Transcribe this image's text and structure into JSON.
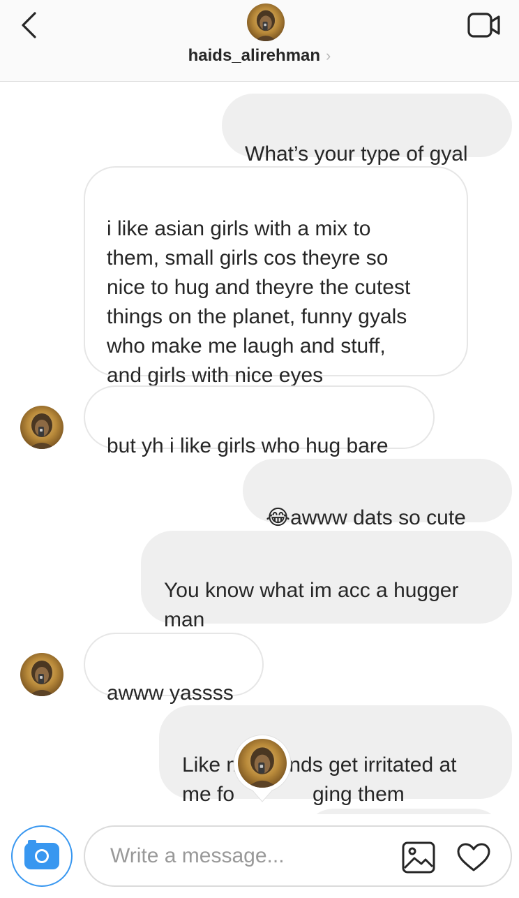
{
  "header": {
    "username": "haids_alirehman",
    "chevron": "›",
    "back_icon": "chevron-left-icon",
    "video_icon": "video-camera-icon"
  },
  "messages": [
    {
      "id": "m1",
      "from": "me",
      "text": "What’s your type of gyal"
    },
    {
      "id": "m2",
      "from": "them",
      "text": "i like asian girls with a mix to\nthem, small girls cos theyre so\nnice to hug and theyre the cutest\nthings on the planet, funny gyals\nwho make me laugh and stuff,\nand girls with nice eyes"
    },
    {
      "id": "m3",
      "from": "them",
      "text": "but yh i like girls who hug bare"
    },
    {
      "id": "m4",
      "from": "me",
      "emoji": "😂",
      "text": "awww dats so cute"
    },
    {
      "id": "m5",
      "from": "me",
      "text": "You know what im acc a hugger\nman"
    },
    {
      "id": "m6",
      "from": "them",
      "text": "awww yassss"
    },
    {
      "id": "m7",
      "from": "me",
      "text_line1": "Like my friends get irritated at",
      "text_line2_start": "me fo",
      "text_line2_end": "ging them"
    }
  ],
  "composer": {
    "placeholder": "Write a message...",
    "camera_icon": "camera-icon",
    "gallery_icon": "image-gallery-icon",
    "heart_icon": "heart-icon"
  },
  "colors": {
    "accent": "#3897f0",
    "sent_bubble": "#efefef",
    "received_border": "#e6e6e6",
    "header_bg": "#fafafa",
    "text": "#262626",
    "placeholder": "#999999"
  }
}
